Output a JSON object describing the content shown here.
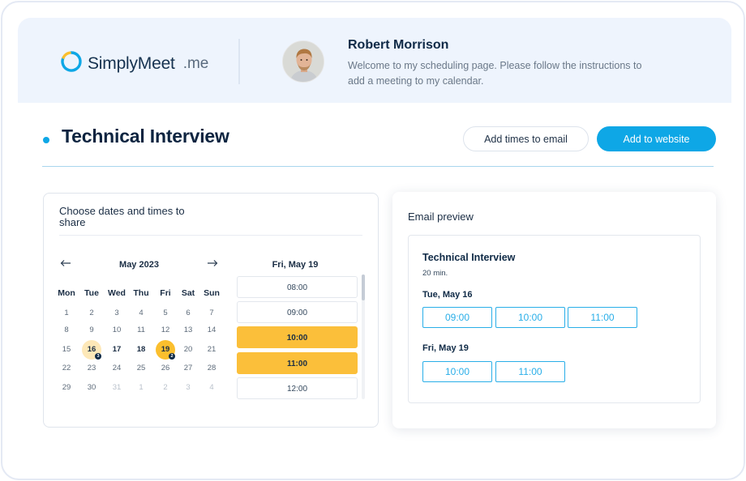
{
  "brand": {
    "name": "SimplyMeet",
    "tld": ".me",
    "accent": "#0ea7e6",
    "logo_icon": "arc-logo-icon"
  },
  "profile": {
    "name": "Robert Morrison",
    "welcome": "Welcome to my scheduling page. Please follow the instructions to add a meeting to my calendar.",
    "avatar_icon": "user-avatar"
  },
  "page": {
    "title": "Technical Interview",
    "add_times_label": "Add times to email",
    "add_website_label": "Add to website"
  },
  "picker": {
    "title": "Choose dates and times to share",
    "prev_icon": "arrow-left-icon",
    "next_icon": "arrow-right-icon",
    "month": "May 2023",
    "weekdays": [
      "Mon",
      "Tue",
      "Wed",
      "Thu",
      "Fri",
      "Sat",
      "Sun"
    ],
    "weeks": [
      [
        {
          "d": "1",
          "s": "normal"
        },
        {
          "d": "2",
          "s": "normal"
        },
        {
          "d": "3",
          "s": "normal"
        },
        {
          "d": "4",
          "s": "normal"
        },
        {
          "d": "5",
          "s": "normal"
        },
        {
          "d": "6",
          "s": "normal"
        },
        {
          "d": "7",
          "s": "normal"
        }
      ],
      [
        {
          "d": "8",
          "s": "normal"
        },
        {
          "d": "9",
          "s": "normal"
        },
        {
          "d": "10",
          "s": "normal"
        },
        {
          "d": "11",
          "s": "normal"
        },
        {
          "d": "12",
          "s": "normal"
        },
        {
          "d": "13",
          "s": "normal"
        },
        {
          "d": "14",
          "s": "normal"
        }
      ],
      [
        {
          "d": "15",
          "s": "normal"
        },
        {
          "d": "16",
          "s": "selected",
          "badge": "3"
        },
        {
          "d": "17",
          "s": "bold"
        },
        {
          "d": "18",
          "s": "bold"
        },
        {
          "d": "19",
          "s": "current",
          "badge": "2"
        },
        {
          "d": "20",
          "s": "normal"
        },
        {
          "d": "21",
          "s": "normal"
        }
      ],
      [
        {
          "d": "22",
          "s": "normal"
        },
        {
          "d": "23",
          "s": "normal"
        },
        {
          "d": "24",
          "s": "normal"
        },
        {
          "d": "25",
          "s": "normal"
        },
        {
          "d": "26",
          "s": "normal"
        },
        {
          "d": "27",
          "s": "normal"
        },
        {
          "d": "28",
          "s": "normal"
        }
      ],
      [
        {
          "d": "29",
          "s": "normal"
        },
        {
          "d": "30",
          "s": "normal"
        },
        {
          "d": "31",
          "s": "muted"
        },
        {
          "d": "1",
          "s": "muted"
        },
        {
          "d": "2",
          "s": "muted"
        },
        {
          "d": "3",
          "s": "muted"
        },
        {
          "d": "4",
          "s": "muted"
        }
      ]
    ],
    "slots_heading": "Fri, May 19",
    "slots": [
      {
        "time": "08:00",
        "active": false
      },
      {
        "time": "09:00",
        "active": false
      },
      {
        "time": "10:00",
        "active": true
      },
      {
        "time": "11:00",
        "active": true
      },
      {
        "time": "12:00",
        "active": false
      }
    ]
  },
  "preview": {
    "title": "Email preview",
    "subject": "Technical Interview",
    "duration": "20 min.",
    "groups": [
      {
        "day": "Tue, May 16",
        "times": [
          "09:00",
          "10:00",
          "11:00"
        ]
      },
      {
        "day": "Fri, May 19",
        "times": [
          "10:00",
          "11:00"
        ]
      }
    ]
  },
  "colors": {
    "selected_day": "#fbbf2e",
    "selected_day_light": "#fde8b8",
    "chip": "#29aee8"
  }
}
